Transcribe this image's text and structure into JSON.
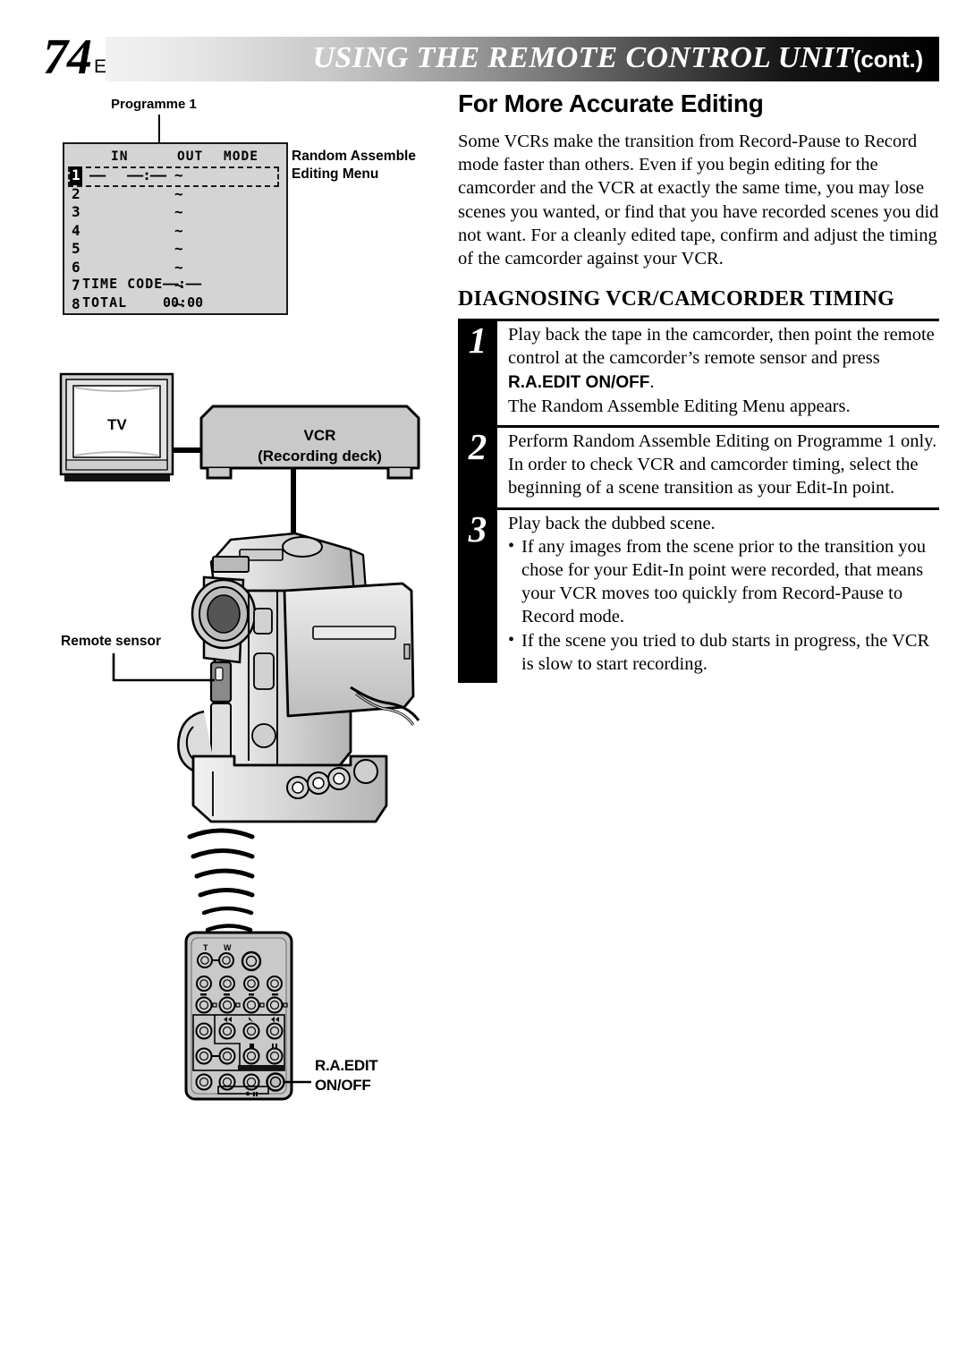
{
  "header": {
    "page_number": "74",
    "language_code": "EN",
    "title": "USING THE REMOTE CONTROL UNIT",
    "cont_suffix": "(cont.)"
  },
  "left_column": {
    "programme_label": "Programme 1",
    "menu_caption": "Random Assemble\nEditing Menu",
    "menu_caption_line1": "Random Assemble",
    "menu_caption_line2": "Editing Menu",
    "osd": {
      "columns": [
        "IN",
        "OUT",
        "MODE"
      ],
      "rows": [
        {
          "num": "1",
          "in_dash": "––",
          "in_time": "––:––",
          "tilde": "~",
          "selected": true
        },
        {
          "num": "2",
          "in_dash": "",
          "in_time": "",
          "tilde": "~",
          "selected": false
        },
        {
          "num": "3",
          "in_dash": "",
          "in_time": "",
          "tilde": "~",
          "selected": false
        },
        {
          "num": "4",
          "in_dash": "",
          "in_time": "",
          "tilde": "~",
          "selected": false
        },
        {
          "num": "5",
          "in_dash": "",
          "in_time": "",
          "tilde": "~",
          "selected": false
        },
        {
          "num": "6",
          "in_dash": "",
          "in_time": "",
          "tilde": "~",
          "selected": false
        },
        {
          "num": "7",
          "in_dash": "",
          "in_time": "",
          "tilde": "~",
          "selected": false
        },
        {
          "num": "8",
          "in_dash": "",
          "in_time": "",
          "tilde": "~",
          "selected": false
        }
      ],
      "time_code_label": "TIME CODE",
      "time_code_value": "––:––",
      "total_label": "TOTAL",
      "total_value": "00:00"
    },
    "diagram": {
      "tv_label": "TV",
      "vcr_label_line1": "VCR",
      "vcr_label_line2": "(Recording deck)",
      "remote_sensor_label": "Remote sensor",
      "remote_button_label_line1": "R.A.EDIT",
      "remote_button_label_line2": "ON/OFF",
      "remote_zoom_tele": "T",
      "remote_zoom_wide": "W"
    }
  },
  "right_column": {
    "section_title": "For More Accurate Editing",
    "intro_paragraph": "Some VCRs make the transition from Record-Pause to Record mode faster than others. Even if you begin editing for the camcorder and the VCR at exactly the same time, you may lose scenes you wanted, or find that you have recorded scenes you did not want. For a cleanly edited tape, confirm and adjust the timing of the camcorder against your VCR.",
    "subsection_title": "DIAGNOSING VCR/CAMCORDER TIMING",
    "steps": [
      {
        "number": "1",
        "text_before_bold": "Play back the tape in the camcorder, then point the remote control at the camcorder’s remote sensor and press ",
        "bold": "R.A.EDIT ON/OFF",
        "text_after_bold": ".",
        "extra_line": "The Random Assemble Editing Menu appears.",
        "bullets": []
      },
      {
        "number": "2",
        "text_before_bold": "Perform Random Assemble Editing on Programme 1 only. In order to check VCR and camcorder timing, select the beginning of a scene transition as your Edit-In point.",
        "bold": "",
        "text_after_bold": "",
        "extra_line": "",
        "bullets": []
      },
      {
        "number": "3",
        "text_before_bold": "Play back the dubbed scene.",
        "bold": "",
        "text_after_bold": "",
        "extra_line": "",
        "bullets": [
          "If any images from the scene prior to the transition you chose for your Edit-In point were recorded, that means your VCR moves too quickly from Record-Pause to Record mode.",
          "If the scene you tried to dub starts in progress, the VCR is slow to start recording."
        ]
      }
    ]
  },
  "colors": {
    "ink": "#000000",
    "osd_background": "#d4d4d4",
    "device_body": "#c9c9c9",
    "paper": "#ffffff"
  }
}
